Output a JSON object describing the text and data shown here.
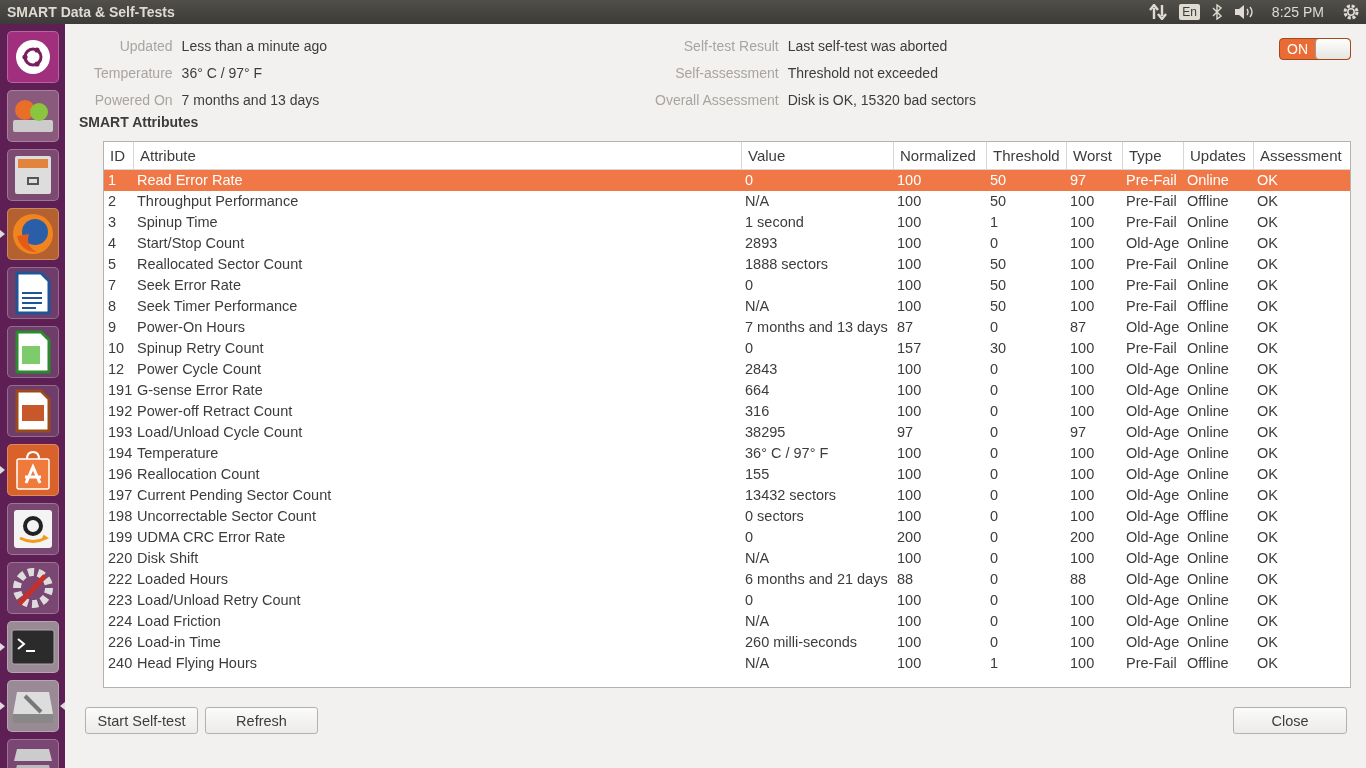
{
  "window": {
    "title": "SMART Data & Self-Tests"
  },
  "top_panel": {
    "keyboard_layout": "En",
    "clock": "8:25 PM"
  },
  "launcher": [
    {
      "kind": "ubuntu",
      "running": false,
      "focused": false
    },
    {
      "kind": "drive-update",
      "running": false,
      "focused": false
    },
    {
      "kind": "files",
      "running": false,
      "focused": false
    },
    {
      "kind": "firefox",
      "running": true,
      "focused": false
    },
    {
      "kind": "writer",
      "running": false,
      "focused": false
    },
    {
      "kind": "calc",
      "running": false,
      "focused": false
    },
    {
      "kind": "impress",
      "running": false,
      "focused": false
    },
    {
      "kind": "software",
      "running": true,
      "focused": false
    },
    {
      "kind": "amazon",
      "running": false,
      "focused": false
    },
    {
      "kind": "settings",
      "running": false,
      "focused": false
    },
    {
      "kind": "terminal",
      "running": true,
      "focused": false
    },
    {
      "kind": "disks",
      "running": true,
      "focused": true
    },
    {
      "kind": "trash",
      "running": false,
      "focused": false
    }
  ],
  "summary_left": [
    {
      "label": "Updated",
      "value": "Less than a minute ago"
    },
    {
      "label": "Temperature",
      "value": "36° C / 97° F"
    },
    {
      "label": "Powered On",
      "value": "7 months and 13 days"
    }
  ],
  "summary_right": [
    {
      "label": "Self-test Result",
      "value": "Last self-test was aborted"
    },
    {
      "label": "Self-assessment",
      "value": "Threshold not exceeded"
    },
    {
      "label": "Overall Assessment",
      "value": "Disk is OK, 15320 bad sectors"
    }
  ],
  "smart_switch": {
    "label": "ON",
    "on": true
  },
  "section_title": "SMART Attributes",
  "table": {
    "columns": [
      "ID",
      "Attribute",
      "Value",
      "Normalized",
      "Threshold",
      "Worst",
      "Type",
      "Updates",
      "Assessment"
    ],
    "rows": [
      {
        "selected": true,
        "cells": [
          "1",
          "Read Error Rate",
          "0",
          "100",
          "50",
          "97",
          "Pre-Fail",
          "Online",
          "OK"
        ]
      },
      {
        "selected": false,
        "cells": [
          "2",
          "Throughput Performance",
          "N/A",
          "100",
          "50",
          "100",
          "Pre-Fail",
          "Offline",
          "OK"
        ]
      },
      {
        "selected": false,
        "cells": [
          "3",
          "Spinup Time",
          "1 second",
          "100",
          "1",
          "100",
          "Pre-Fail",
          "Online",
          "OK"
        ]
      },
      {
        "selected": false,
        "cells": [
          "4",
          "Start/Stop Count",
          "2893",
          "100",
          "0",
          "100",
          "Old-Age",
          "Online",
          "OK"
        ]
      },
      {
        "selected": false,
        "cells": [
          "5",
          "Reallocated Sector Count",
          "1888 sectors",
          "100",
          "50",
          "100",
          "Pre-Fail",
          "Online",
          "OK"
        ]
      },
      {
        "selected": false,
        "cells": [
          "7",
          "Seek Error Rate",
          "0",
          "100",
          "50",
          "100",
          "Pre-Fail",
          "Online",
          "OK"
        ]
      },
      {
        "selected": false,
        "cells": [
          "8",
          "Seek Timer Performance",
          "N/A",
          "100",
          "50",
          "100",
          "Pre-Fail",
          "Offline",
          "OK"
        ]
      },
      {
        "selected": false,
        "cells": [
          "9",
          "Power-On Hours",
          "7 months and 13 days",
          "87",
          "0",
          "87",
          "Old-Age",
          "Online",
          "OK"
        ]
      },
      {
        "selected": false,
        "cells": [
          "10",
          "Spinup Retry Count",
          "0",
          "157",
          "30",
          "100",
          "Pre-Fail",
          "Online",
          "OK"
        ]
      },
      {
        "selected": false,
        "cells": [
          "12",
          "Power Cycle Count",
          "2843",
          "100",
          "0",
          "100",
          "Old-Age",
          "Online",
          "OK"
        ]
      },
      {
        "selected": false,
        "cells": [
          "191",
          "G-sense Error Rate",
          "664",
          "100",
          "0",
          "100",
          "Old-Age",
          "Online",
          "OK"
        ]
      },
      {
        "selected": false,
        "cells": [
          "192",
          "Power-off Retract Count",
          "316",
          "100",
          "0",
          "100",
          "Old-Age",
          "Online",
          "OK"
        ]
      },
      {
        "selected": false,
        "cells": [
          "193",
          "Load/Unload Cycle Count",
          "38295",
          "97",
          "0",
          "97",
          "Old-Age",
          "Online",
          "OK"
        ]
      },
      {
        "selected": false,
        "cells": [
          "194",
          "Temperature",
          "36° C / 97° F",
          "100",
          "0",
          "100",
          "Old-Age",
          "Online",
          "OK"
        ]
      },
      {
        "selected": false,
        "cells": [
          "196",
          "Reallocation Count",
          "155",
          "100",
          "0",
          "100",
          "Old-Age",
          "Online",
          "OK"
        ]
      },
      {
        "selected": false,
        "cells": [
          "197",
          "Current Pending Sector Count",
          "13432 sectors",
          "100",
          "0",
          "100",
          "Old-Age",
          "Online",
          "OK"
        ]
      },
      {
        "selected": false,
        "cells": [
          "198",
          "Uncorrectable Sector Count",
          "0 sectors",
          "100",
          "0",
          "100",
          "Old-Age",
          "Offline",
          "OK"
        ]
      },
      {
        "selected": false,
        "cells": [
          "199",
          "UDMA CRC Error Rate",
          "0",
          "200",
          "0",
          "200",
          "Old-Age",
          "Online",
          "OK"
        ]
      },
      {
        "selected": false,
        "cells": [
          "220",
          "Disk Shift",
          "N/A",
          "100",
          "0",
          "100",
          "Old-Age",
          "Online",
          "OK"
        ]
      },
      {
        "selected": false,
        "cells": [
          "222",
          "Loaded Hours",
          "6 months and 21 days",
          "88",
          "0",
          "88",
          "Old-Age",
          "Online",
          "OK"
        ]
      },
      {
        "selected": false,
        "cells": [
          "223",
          "Load/Unload Retry Count",
          "0",
          "100",
          "0",
          "100",
          "Old-Age",
          "Online",
          "OK"
        ]
      },
      {
        "selected": false,
        "cells": [
          "224",
          "Load Friction",
          "N/A",
          "100",
          "0",
          "100",
          "Old-Age",
          "Online",
          "OK"
        ]
      },
      {
        "selected": false,
        "cells": [
          "226",
          "Load-in Time",
          "260 milli-seconds",
          "100",
          "0",
          "100",
          "Old-Age",
          "Online",
          "OK"
        ]
      },
      {
        "selected": false,
        "cells": [
          "240",
          "Head Flying Hours",
          "N/A",
          "100",
          "1",
          "100",
          "Pre-Fail",
          "Offline",
          "OK"
        ]
      }
    ]
  },
  "buttons_left": [
    "Start Self-test",
    "Refresh"
  ],
  "buttons_right": [
    "Close"
  ]
}
